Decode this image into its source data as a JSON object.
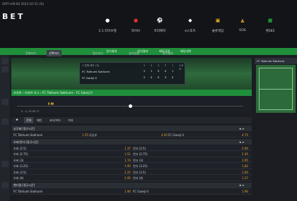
{
  "clock": "GMT+09:00  2023-10-31 (화)",
  "logo": "BET",
  "nav": [
    {
      "label": "1:1 라이브챗",
      "icon": "avatar-icon",
      "color": "#ffffff"
    },
    {
      "label": "라이브",
      "icon": "live-icon",
      "color": "#e0322f"
    },
    {
      "label": "프리매치",
      "icon": "soccer-ball-icon",
      "color": "#ffffff"
    },
    {
      "label": "e스포츠",
      "icon": "esports-icon",
      "color": "#ffffff"
    },
    {
      "label": "슬롯게임",
      "icon": "slot-icon",
      "color": "#e8b020"
    },
    {
      "label": "EOS",
      "icon": "eos-icon",
      "color": "#c08a2a"
    },
    {
      "label": "벳365",
      "icon": "bet365-icon",
      "color": "#1f8f3b"
    }
  ],
  "subnav": [
    "경기결과",
    "경기결과",
    "베팅규정",
    "배팅내역"
  ],
  "tabs": [
    "전체보기",
    "선택하기",
    "멀티보기",
    "경기일정",
    "경기결과"
  ],
  "score": {
    "header": "1 전체 레드 (3)",
    "team1": "FC Tskhumi Sokhumi",
    "team2": "FC Gareji II",
    "cols": [
      "2",
      "0",
      "0",
      "P",
      "1",
      "스코어"
    ],
    "t1": [
      "2",
      "1",
      "0",
      "0",
      "1",
      ""
    ],
    "t2": [
      "2",
      "0",
      "0",
      "0",
      "0",
      ""
    ]
  },
  "match_title": "조지아 › 리저브 리그 › FC Tskhumi Sokhumi – FC Gareji II",
  "timeline_label": "0 - 0, 25:00 1T",
  "market_tabs": [
    "★",
    "전체",
    "메인",
    "코너/카드",
    "기타"
  ],
  "markets": [
    {
      "title": "승무패 [정규시간]",
      "rows": [
        {
          "a": "FC Tskhumi Sokhumi",
          "oa": "1.55",
          "b": "무승부",
          "ob": "4.05",
          "c": "FC Gareji II",
          "oc": "4.75"
        }
      ]
    },
    {
      "title": "오버/언더 [정규시간]",
      "rows": [
        {
          "a": "오버 (2.5)",
          "oa": "1.37",
          "b": "언더 (2.5)",
          "ob": "2.90"
        },
        {
          "a": "오버 (2.75)",
          "oa": "1.51",
          "b": "언더 (2.75)",
          "ob": "2.45"
        },
        {
          "a": "오버 (3)",
          "oa": "1.74",
          "b": "언더 (3)",
          "ob": "2.05"
        },
        {
          "a": "오버 (3.25)",
          "oa": "1.95",
          "b": "언더 (3.25)",
          "ob": "1.82"
        },
        {
          "a": "오버 (3.5)",
          "oa": "2.25",
          "b": "언더 (3.5)",
          "ob": "1.60"
        },
        {
          "a": "오버 (4)",
          "oa": "2.95",
          "b": "언더 (4)",
          "ob": "1.37"
        }
      ]
    },
    {
      "title": "핸디캡 [정규시간]",
      "rows": [
        {
          "a": "FC Tskhumi Sokhumi",
          "oa": "1.90",
          "b": "FC Gareji II",
          "ob": "1.90"
        }
      ]
    }
  ],
  "right_title": "FC Tskhumi Sokhumi"
}
